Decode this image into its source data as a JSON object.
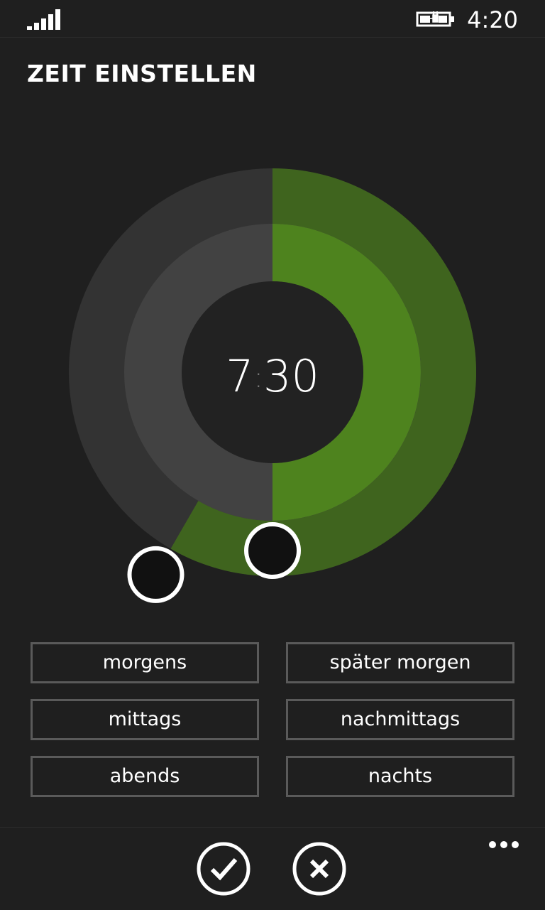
{
  "status_bar": {
    "time": "4:20",
    "signal_icon": "signal-strength-icon",
    "battery_icon": "battery-charging-icon"
  },
  "page": {
    "title": "ZEIT EINSTELLEN"
  },
  "time_picker": {
    "hours": "7",
    "separator": ":",
    "minutes": "30",
    "hour_value": 7,
    "minute_value": 30,
    "colors": {
      "background": "#1f1f1f",
      "outer_track": "#333333",
      "inner_track": "#424242",
      "outer_active": "#3f641e",
      "inner_active": "#4e831e",
      "center": "#222222",
      "handle": "#111111",
      "handle_border": "#ffffff"
    }
  },
  "presets": [
    {
      "label": "morgens"
    },
    {
      "label": "später morgen"
    },
    {
      "label": "mittags"
    },
    {
      "label": "nachmittags"
    },
    {
      "label": "abends"
    },
    {
      "label": "nachts"
    }
  ],
  "app_bar": {
    "confirm_icon": "checkmark-icon",
    "cancel_icon": "close-icon",
    "more_icon": "ellipsis-icon"
  }
}
